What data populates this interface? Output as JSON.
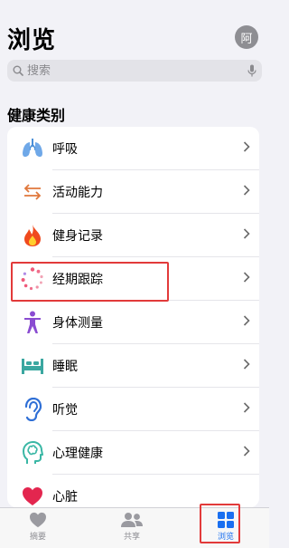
{
  "header": {
    "title": "浏览",
    "avatar_text": "阿"
  },
  "search": {
    "placeholder": "搜索"
  },
  "section": {
    "title": "健康类别"
  },
  "categories": [
    {
      "label": "呼吸",
      "icon": "lungs-icon"
    },
    {
      "label": "活动能力",
      "icon": "arrows-icon"
    },
    {
      "label": "健身记录",
      "icon": "flame-icon"
    },
    {
      "label": "经期跟踪",
      "icon": "cycle-icon"
    },
    {
      "label": "身体测量",
      "icon": "figure-icon"
    },
    {
      "label": "睡眠",
      "icon": "bed-icon"
    },
    {
      "label": "听觉",
      "icon": "ear-icon"
    },
    {
      "label": "心理健康",
      "icon": "head-icon"
    },
    {
      "label": "心脏",
      "icon": "heart-icon"
    }
  ],
  "tabs": [
    {
      "label": "摘要",
      "icon": "heart-icon"
    },
    {
      "label": "共享",
      "icon": "people-icon"
    },
    {
      "label": "浏览",
      "icon": "grid-icon"
    }
  ],
  "colors": {
    "accent": "#1a6ff0",
    "highlight": "#e23a3a"
  }
}
